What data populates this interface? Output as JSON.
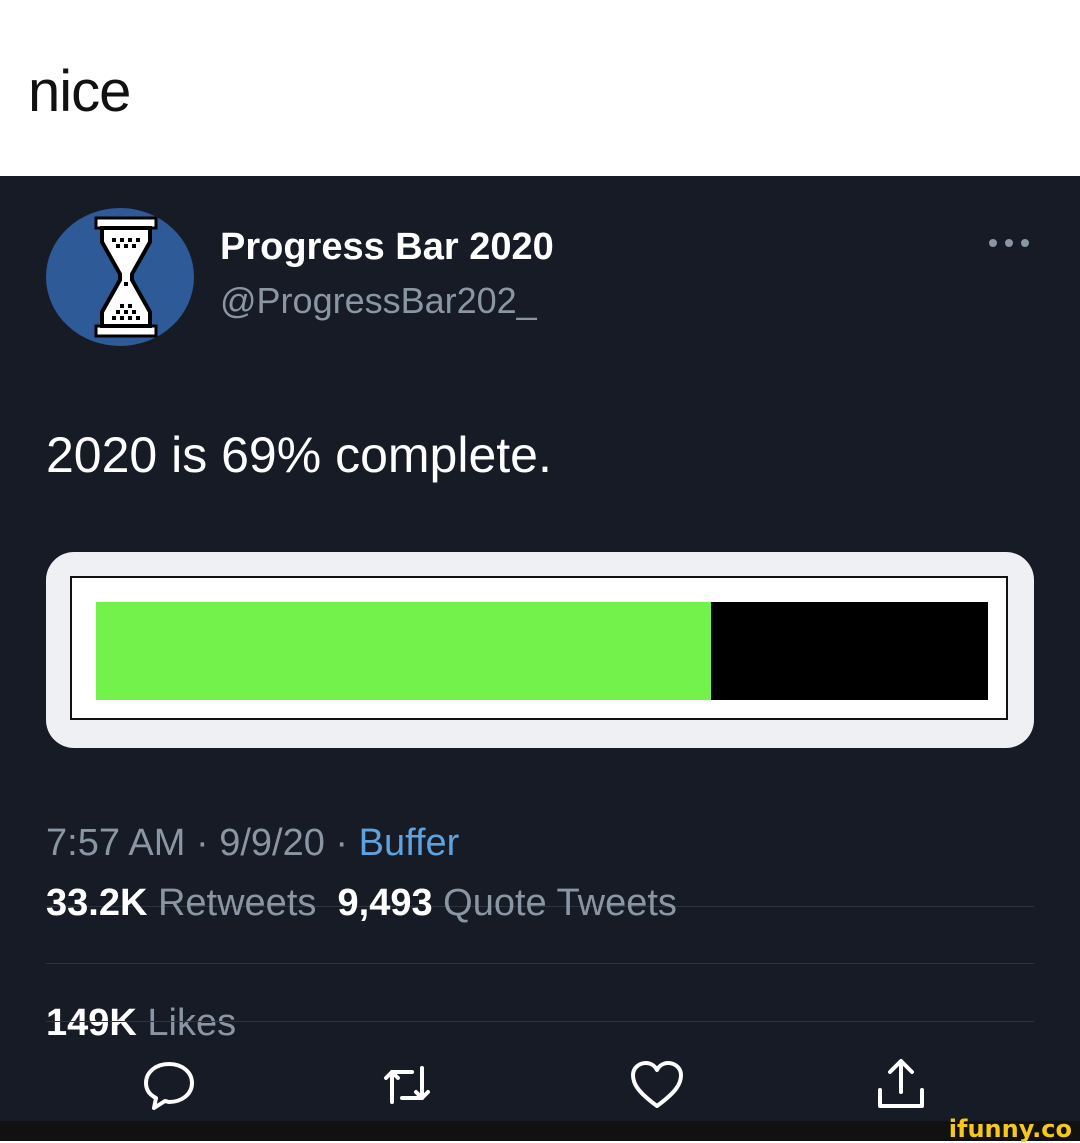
{
  "caption": {
    "text": "nice"
  },
  "tweet": {
    "display_name": "Progress Bar 2020",
    "handle": "@ProgressBar202_",
    "text": "2020 is 69% complete.",
    "progress_fraction": 0.69,
    "progress_fill_color": "#73f24c",
    "progress_track_color": "#000000",
    "time": "7:57 AM",
    "separator": "·",
    "date": "9/9/20",
    "source": "Buffer",
    "retweets_count": "33.2K",
    "retweets_label": "Retweets",
    "quotes_count": "9,493",
    "quotes_label": "Quote Tweets",
    "likes_count": "149K",
    "likes_label": "Likes"
  },
  "actions": [
    "reply-icon",
    "retweet-icon",
    "like-icon",
    "share-icon"
  ],
  "colors": {
    "background": "#161b25",
    "accent": "#5ea2e0",
    "muted": "#8a96a3"
  },
  "watermark": {
    "text": "ifunny.co"
  }
}
